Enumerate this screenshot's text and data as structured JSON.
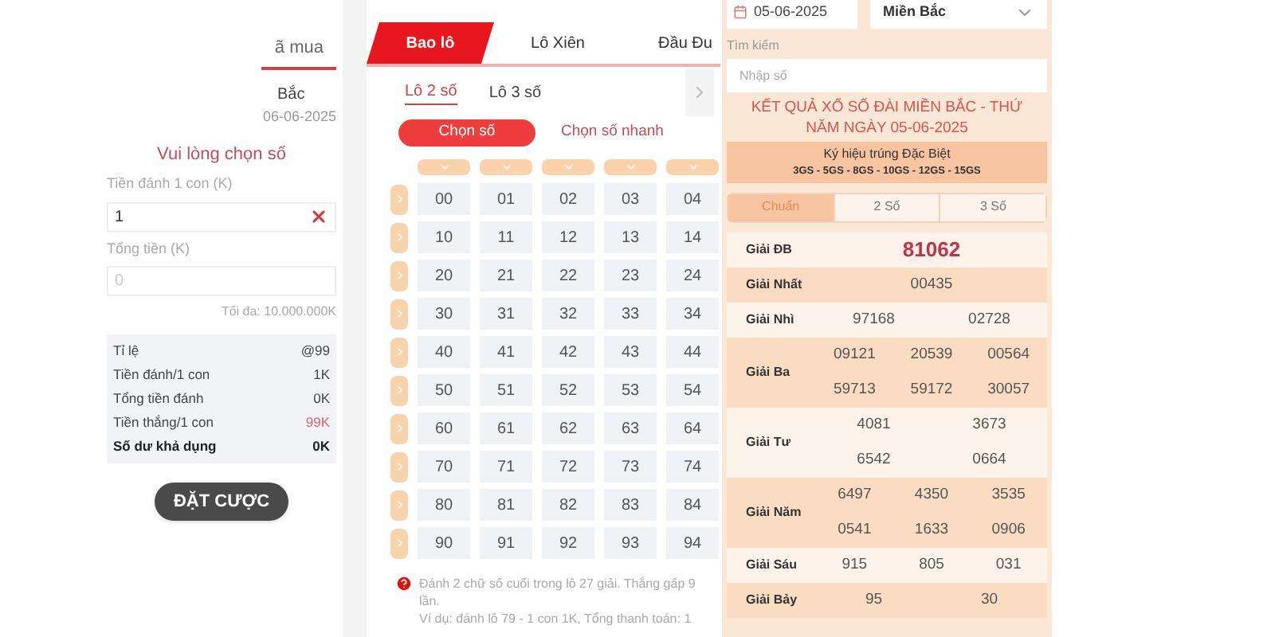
{
  "left_panel": {
    "tab": "ã mua",
    "region": "Bắc",
    "date": "06-06-2025",
    "prompt": "Vui lòng chọn số",
    "fields": [
      {
        "label": "Tiền đánh 1 con (K)",
        "value": "1",
        "clearable": true
      },
      {
        "label": "Tổng tiền (K)",
        "placeholder": "0",
        "clearable": false
      }
    ],
    "max_note": "Tối đa: 10.000.000K",
    "summary": [
      {
        "label": "Tỉ lệ",
        "value": "@99",
        "kind": "plain"
      },
      {
        "label": "Tiền đánh/1 con",
        "value": "1K",
        "kind": "plain"
      },
      {
        "label": "Tổng tiền đánh",
        "value": "0K",
        "kind": "plain"
      },
      {
        "label": "Tiền thắng/1 con",
        "value": "99K",
        "kind": "win"
      },
      {
        "label": "Số dư khả dụng",
        "value": "0K",
        "kind": "total"
      }
    ],
    "submit": "ĐẶT CƯỢC"
  },
  "bet_panel": {
    "bet_tabs": [
      {
        "label": "Bao lô",
        "selected": true
      },
      {
        "label": "Lô Xiên",
        "selected": false
      },
      {
        "label": "Đầu Đu",
        "selected": false
      }
    ],
    "digit_tabs": [
      {
        "label": "Lô 2 số",
        "selected": true
      },
      {
        "label": "Lô 3 số",
        "selected": false
      }
    ],
    "modes": [
      {
        "label": "Chọn số",
        "selected": true
      },
      {
        "label": "Chọn số nhanh",
        "selected": false
      }
    ],
    "number_rows": [
      [
        "00",
        "01",
        "02",
        "03",
        "04"
      ],
      [
        "10",
        "11",
        "12",
        "13",
        "14"
      ],
      [
        "20",
        "21",
        "22",
        "23",
        "24"
      ],
      [
        "30",
        "31",
        "32",
        "33",
        "34"
      ],
      [
        "40",
        "41",
        "42",
        "43",
        "44"
      ],
      [
        "50",
        "51",
        "52",
        "53",
        "54"
      ],
      [
        "60",
        "61",
        "62",
        "63",
        "64"
      ],
      [
        "70",
        "71",
        "72",
        "73",
        "74"
      ],
      [
        "80",
        "81",
        "82",
        "83",
        "84"
      ],
      [
        "90",
        "91",
        "92",
        "93",
        "94"
      ]
    ],
    "note_lines": [
      "Đánh 2 chữ số cuối trong lô 27 giải. Thắng gấp 9",
      "lần.",
      "Ví dụ: đánh lô 79 - 1 con 1K, Tổng thanh toán: 1"
    ]
  },
  "results_panel": {
    "date": "05-06-2025",
    "region": "Miền Bắc",
    "search_label": "Tìm kiếm",
    "search_placeholder": "Nhập số",
    "title": "KẾT QUẢ XỔ SỐ ĐÀI MIỀN BẮC - THỨ NĂM NGÀY 05-06-2025",
    "special_label": "Ký hiệu trúng Đặc Biệt",
    "special_codes": "3GS - 5GS - 8GS - 10GS - 12GS - 15GS",
    "tabs": [
      {
        "label": "Chuẩn",
        "selected": true
      },
      {
        "label": "2 Số",
        "selected": false
      },
      {
        "label": "3 Số",
        "selected": false
      }
    ],
    "prizes": [
      {
        "label": "Giải ĐB",
        "kind": "jackpot",
        "lines": [
          [
            "81062"
          ]
        ]
      },
      {
        "label": "Giải Nhất",
        "kind": "normal",
        "lines": [
          [
            "00435"
          ]
        ]
      },
      {
        "label": "Giải Nhì",
        "kind": "normal",
        "lines": [
          [
            "97168",
            "02728"
          ]
        ]
      },
      {
        "label": "Giải Ba",
        "kind": "normal",
        "lines": [
          [
            "09121",
            "20539",
            "00564"
          ],
          [
            "59713",
            "59172",
            "30057"
          ]
        ]
      },
      {
        "label": "Giải Tư",
        "kind": "normal",
        "lines": [
          [
            "4081",
            "3673"
          ],
          [
            "6542",
            "0664"
          ]
        ]
      },
      {
        "label": "Giải Năm",
        "kind": "normal",
        "lines": [
          [
            "6497",
            "4350",
            "3535"
          ],
          [
            "0541",
            "1633",
            "0906"
          ]
        ]
      },
      {
        "label": "Giải Sáu",
        "kind": "normal",
        "lines": [
          [
            "915",
            "805",
            "031"
          ]
        ]
      },
      {
        "label": "Giải Bảy",
        "kind": "normal",
        "lines": [
          [
            "95",
            "30"
          ]
        ]
      }
    ]
  }
}
